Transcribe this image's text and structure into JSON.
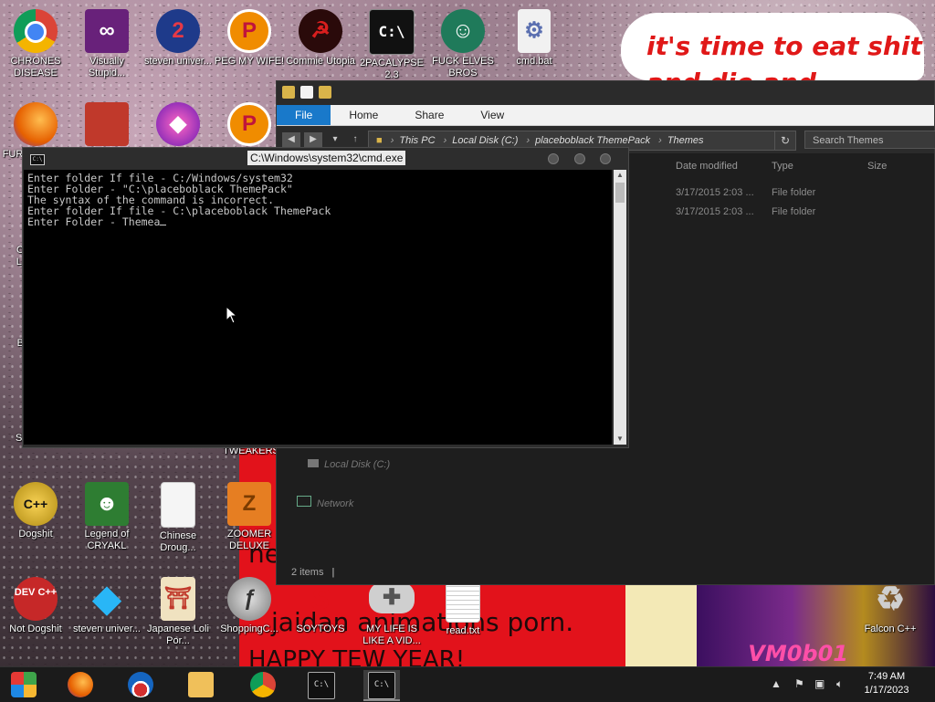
{
  "desktop": {
    "icons": [
      {
        "name": "chrome-icon",
        "label": "CHRONES DISEASE",
        "glyph": "",
        "color": "#db4437"
      },
      {
        "name": "visual-studio-icon",
        "label": "Visually Stupid...",
        "glyph": "∞",
        "color": "#68217a"
      },
      {
        "name": "steven-universe-2-icon",
        "label": "steven univer...",
        "glyph": "2",
        "color": "#d62828"
      },
      {
        "name": "peg-icon-1",
        "label": "PEG MY WIFE!",
        "glyph": "P",
        "color": "#f08c00"
      },
      {
        "name": "commie-utopia-icon",
        "label": "Commie Utopia",
        "glyph": "☭",
        "color": "#b01010"
      },
      {
        "name": "2pacalypse-icon",
        "label": "2PACALYPSE 2.3",
        "glyph": "C:\\",
        "color": "#111111"
      },
      {
        "name": "elves-bros-icon",
        "label": "FUCK ELVES BROS",
        "glyph": "☺",
        "color": "#1f7a5a"
      },
      {
        "name": "cmd-bat-icon",
        "label": "cmd.bat",
        "glyph": "⚙",
        "color": "#e8e8e8"
      },
      {
        "name": "firefox-icon",
        "label": "FUR",
        "glyph": "",
        "color": "#e66000"
      },
      {
        "name": "angry-birds-icon",
        "label": "",
        "glyph": "",
        "color": "#c0392b"
      },
      {
        "name": "gem-icon",
        "label": "",
        "glyph": "◆",
        "color": "#a23bd6"
      },
      {
        "name": "peg-icon-2",
        "label": "",
        "glyph": "P",
        "color": "#f08c00"
      },
      {
        "name": "dogshit-icon",
        "label": "Dogshit",
        "glyph": "C++",
        "color": "#caa017"
      },
      {
        "name": "legend-cryakl-icon",
        "label": "Legend of CRYAKL",
        "glyph": "☻",
        "color": "#2e7d32"
      },
      {
        "name": "chinese-drougs-icon",
        "label": "Chinese Droug...",
        "glyph": "",
        "color": "#f5f5f5"
      },
      {
        "name": "zoomer-deluxe-icon",
        "label": "ZOOMER DELUXE",
        "glyph": "Z",
        "color": "#e67e22"
      },
      {
        "name": "dev-cpp-icon",
        "label": "Not Dogshit",
        "glyph": "DEV C++",
        "color": "#c62828"
      },
      {
        "name": "steven-universe-gem-icon",
        "label": "steven univer...",
        "glyph": "◆",
        "color": "#29b6f6"
      },
      {
        "name": "japanese-icon",
        "label": "Japanese Loli Por...",
        "glyph": "⛩",
        "color": "#f0e2c0"
      },
      {
        "name": "flash-icon",
        "label": "ShoppingC...",
        "glyph": "ƒ",
        "color": "#9e9e9e"
      },
      {
        "name": "soytoys-icon",
        "label": "SOYTOYS",
        "glyph": "S",
        "color": "#e2121b"
      },
      {
        "name": "gamepad-icon",
        "label": "MY LIFE IS LIKE A VID...",
        "glyph": "✚",
        "color": "#bdbdbd"
      },
      {
        "name": "read-txt-icon",
        "label": "read.txt",
        "glyph": "",
        "color": "#f5f5f5"
      },
      {
        "name": "recycle-bin-icon",
        "label": "Falcon C++",
        "glyph": "♻",
        "color": "#9e9e9e"
      }
    ],
    "partial_labels": {
      "os": "OS",
      "la": "LAI",
      "be": "BE",
      "sex": "SEX",
      "tweakers": "TWEAKERS"
    },
    "speech_bubble_line1": "it's time to eat shit",
    "speech_bubble_line2": "and die and",
    "poster_line1": "ne",
    "poster_line2": "jaidan animations porn.",
    "poster_line3": "HAPPY TEW YEAR!",
    "watermark": "VM0b01"
  },
  "explorer": {
    "tabs": [
      "File",
      "Home",
      "Share",
      "View"
    ],
    "breadcrumb": [
      "This PC",
      "Local Disk (C:)",
      "placeboblack ThemePack",
      "Themes"
    ],
    "search_placeholder": "Search Themes",
    "columns": {
      "date": "Date modified",
      "type": "Type",
      "size": "Size"
    },
    "rows": [
      {
        "date": "3/17/2015 2:03 ...",
        "type": "File folder"
      },
      {
        "date": "3/17/2015 2:03 ...",
        "type": "File folder"
      }
    ],
    "nav_local_disk": "Local Disk (C:)",
    "nav_network": "Network",
    "status": "2 items"
  },
  "cmd": {
    "title": "C:\\Windows\\system32\\cmd.exe",
    "lines": [
      "Enter folder If file - C:/Windows/system32",
      "Enter Folder - \"C:\\placeboblack ThemePack\"",
      "The syntax of the command is incorrect.",
      "Enter folder If file - C:\\placeboblack ThemePack",
      "Enter Folder - Themea"
    ]
  },
  "taskbar": {
    "time": "7:49 AM",
    "date": "1/17/2023"
  }
}
